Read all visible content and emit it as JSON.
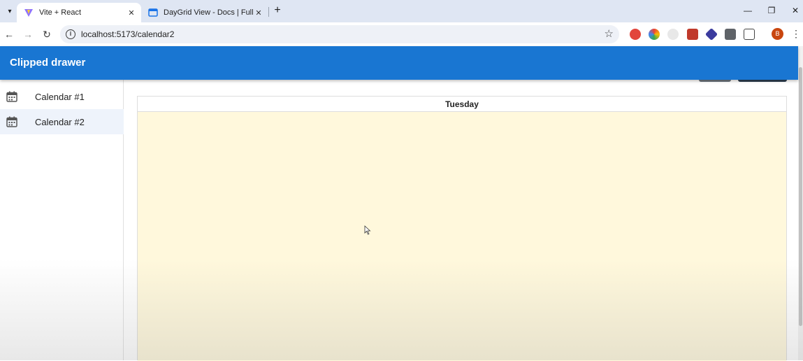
{
  "browser": {
    "tabs": [
      {
        "title": "Vite + React",
        "active": true
      },
      {
        "title": "DayGrid View - Docs | FullCale",
        "active": false
      }
    ],
    "url": "localhost:5173/calendar2",
    "profile_initial": "B"
  },
  "appbar": {
    "title": "Clipped drawer",
    "color": "#1976d2"
  },
  "drawer": {
    "items": [
      {
        "label": "Calendar #1",
        "icon": "calendar-icon",
        "selected": false
      },
      {
        "label": "Calendar #2",
        "icon": "calendar-icon",
        "selected": true
      }
    ]
  },
  "calendar": {
    "day_header": "Tuesday",
    "today_color": "#fff8dc"
  }
}
